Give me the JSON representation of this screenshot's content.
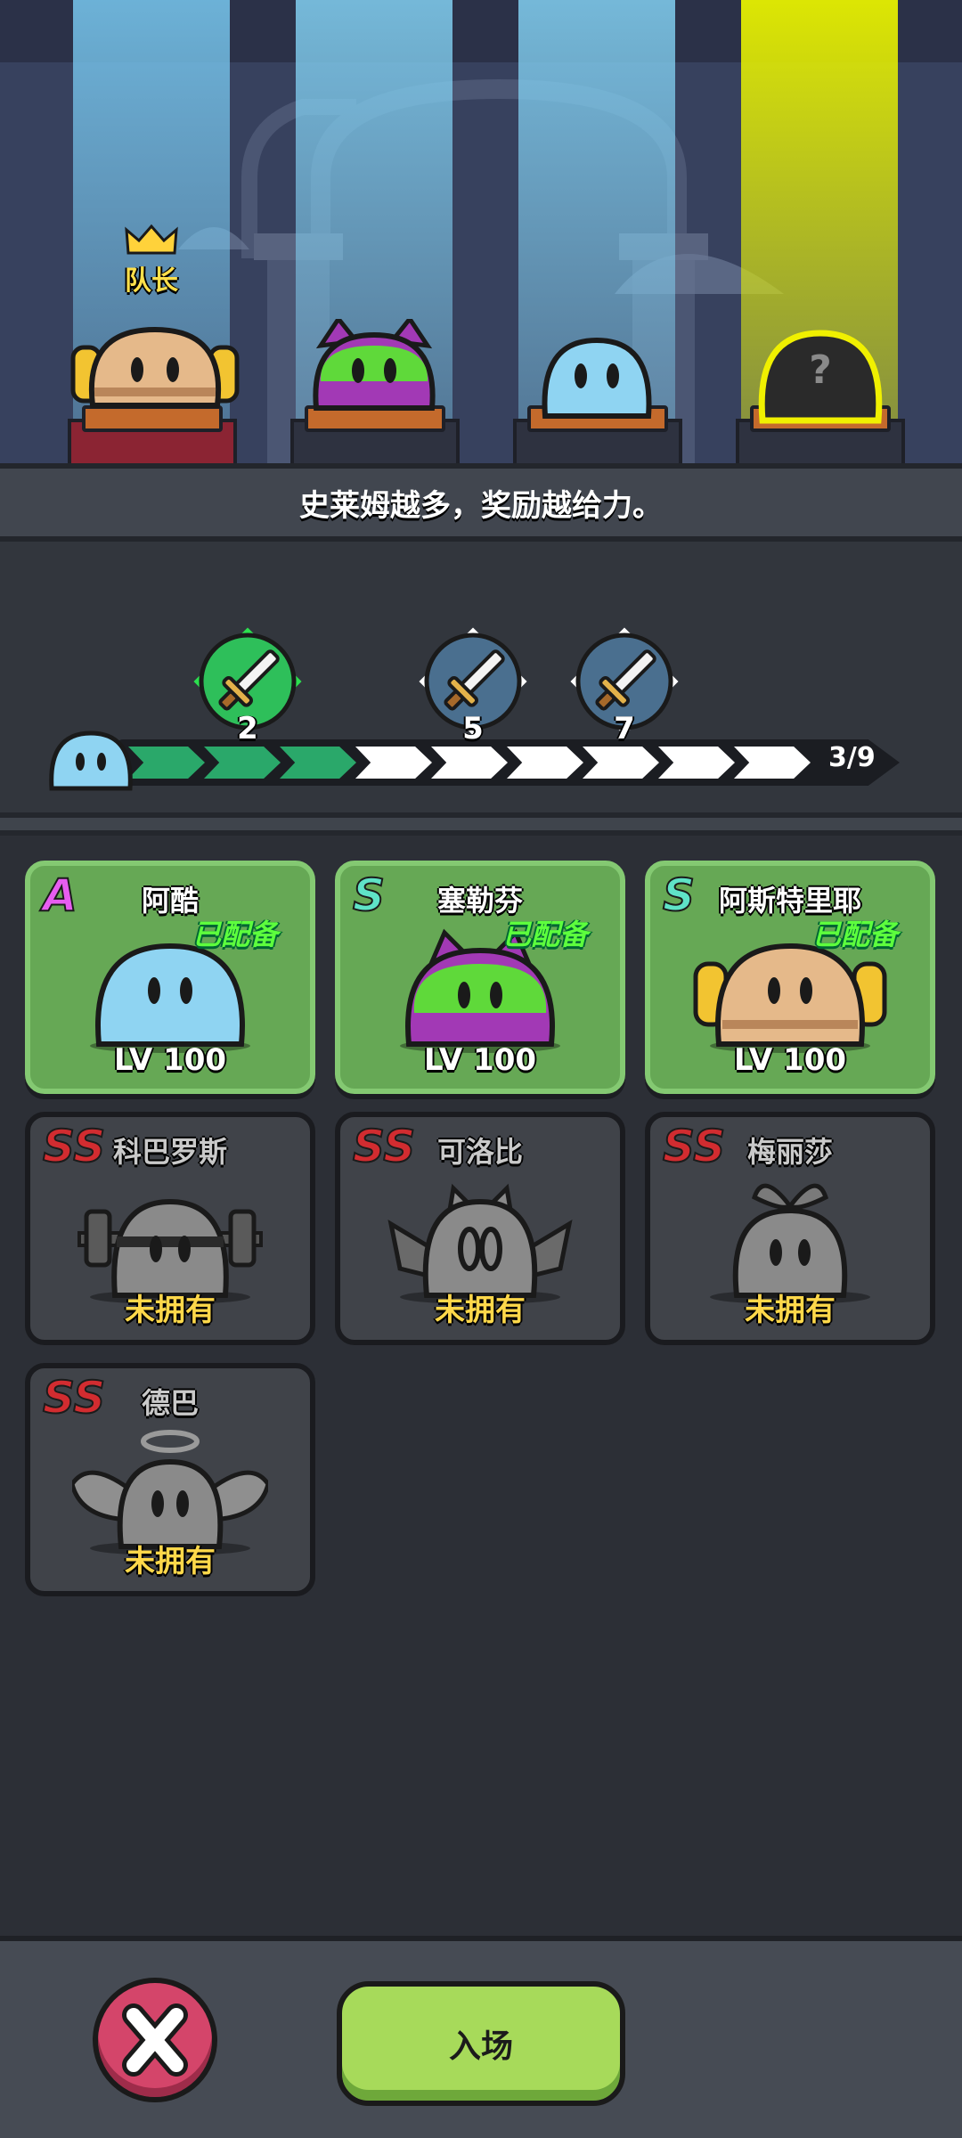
{
  "stage": {
    "leader_label": "队长",
    "hint": "史莱姆越多，奖励越给力。",
    "slots": [
      {
        "slime": "astrid-slime",
        "beam": "#7fc8ee"
      },
      {
        "slime": "cyrfin-slime",
        "beam": "#8fd0f0"
      },
      {
        "slime": "aku-slime",
        "beam": "#8fd0f0"
      },
      {
        "slime": "unknown-slime",
        "beam": "#e6f000",
        "mark": "?"
      }
    ]
  },
  "progress": {
    "current": 3,
    "total": 9,
    "count_text": "3/9",
    "milestones": [
      {
        "value": "2",
        "reached": true
      },
      {
        "value": "5",
        "reached": false
      },
      {
        "value": "7",
        "reached": false
      }
    ],
    "colors": {
      "filled": "#2aa86a",
      "empty": "#ffffff"
    }
  },
  "cards": [
    {
      "rank": "A",
      "name": "阿酷",
      "status": "已配备",
      "level": "LV 100",
      "owned": true,
      "slime": "blue"
    },
    {
      "rank": "S",
      "name": "塞勒芬",
      "status": "已配备",
      "level": "LV 100",
      "owned": true,
      "slime": "green-cat"
    },
    {
      "rank": "S",
      "name": "阿斯特里耶",
      "status": "已配备",
      "level": "LV 100",
      "owned": true,
      "slime": "tan-headphones"
    },
    {
      "rank": "SS",
      "name": "科巴罗斯",
      "status": "未拥有",
      "owned": false,
      "slime": "barbell"
    },
    {
      "rank": "SS",
      "name": "可洛比",
      "status": "未拥有",
      "owned": false,
      "slime": "bat"
    },
    {
      "rank": "SS",
      "name": "梅丽莎",
      "status": "未拥有",
      "owned": false,
      "slime": "sprout"
    },
    {
      "rank": "SS",
      "name": "德巴",
      "status": "未拥有",
      "owned": false,
      "slime": "angel"
    }
  ],
  "footer": {
    "enter_label": "入场",
    "close_icon": "close-icon"
  }
}
